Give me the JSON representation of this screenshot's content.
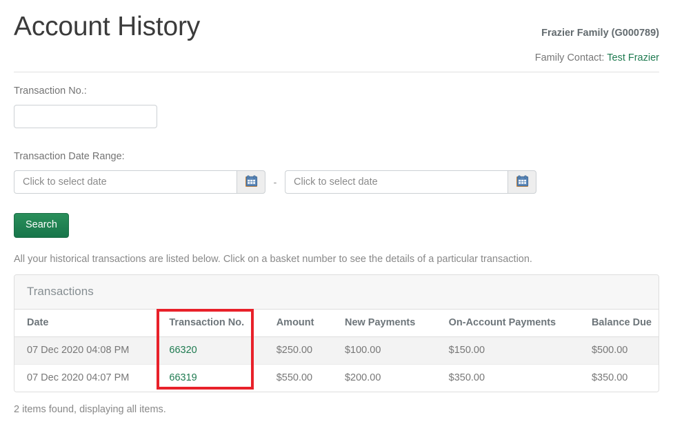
{
  "header": {
    "title": "Account History",
    "account_name": "Frazier Family (G000789)",
    "family_contact_label": "Family Contact:",
    "family_contact_name": "Test Frazier"
  },
  "form": {
    "transaction_no_label": "Transaction No.:",
    "transaction_no_value": "",
    "transaction_no_placeholder": "",
    "date_range_label": "Transaction Date Range:",
    "date_from_value": "",
    "date_from_placeholder": "Click to select date",
    "date_to_value": "",
    "date_to_placeholder": "Click to select date",
    "range_separator": "-",
    "calendar_icon": "calendar-icon",
    "search_label": "Search"
  },
  "intro_text": "All your historical transactions are listed below. Click on a basket number to see the details of a particular transaction.",
  "panel": {
    "heading": "Transactions",
    "columns": [
      "Date",
      "Transaction No.",
      "Amount",
      "New Payments",
      "On-Account Payments",
      "Balance Due"
    ],
    "rows": [
      {
        "date": "07 Dec 2020 04:08 PM",
        "transaction_no": "66320",
        "amount": "$250.00",
        "new_payments": "$100.00",
        "on_account_payments": "$150.00",
        "balance_due": "$500.00"
      },
      {
        "date": "07 Dec 2020 04:07 PM",
        "transaction_no": "66319",
        "amount": "$550.00",
        "new_payments": "$200.00",
        "on_account_payments": "$350.00",
        "balance_due": "$350.00"
      }
    ]
  },
  "footer_text": "2 items found, displaying all items.",
  "colors": {
    "link_green": "#1e7a50",
    "button_green": "#1c7c4f",
    "annotation_red": "#e8212a",
    "text_gray": "#777777",
    "heading_gray": "#6d757a"
  }
}
